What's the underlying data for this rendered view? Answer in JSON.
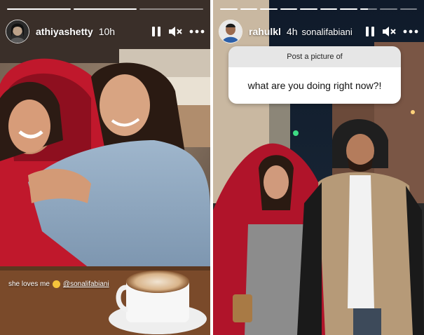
{
  "left_story": {
    "username": "athiyashetty",
    "timestamp": "10h",
    "progress_fractions": [
      1,
      1,
      0
    ],
    "caption_text": "she loves me",
    "caption_emoji": "hugging-face-emoji",
    "caption_mention": "@sonalifabiani",
    "icons": {
      "pause": "pause-icon",
      "mute": "muted-speaker-icon",
      "more": "more-icon"
    }
  },
  "right_story": {
    "username": "rahulkl",
    "timestamp": "4h",
    "mention": "sonalifabiani",
    "progress_fractions": [
      1,
      1,
      1,
      1,
      1,
      1,
      1,
      0.45,
      0,
      0
    ],
    "question_label": "Post a picture of",
    "question_text": "what are you doing right now?!",
    "icons": {
      "pause": "pause-icon",
      "mute": "muted-speaker-icon",
      "more": "more-icon"
    }
  },
  "colors": {
    "question_header_bg": "#e6e6e6",
    "question_body_bg": "#ffffff",
    "progress_fill": "#ffffff"
  }
}
